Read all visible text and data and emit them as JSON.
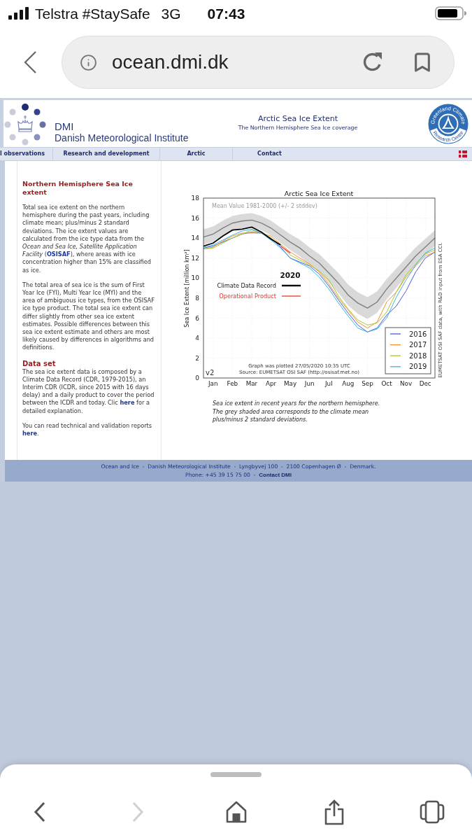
{
  "status_bar": {
    "carrier": "Telstra #StaySafe",
    "network": "3G",
    "time": "07:43"
  },
  "address_bar": {
    "url": "ocean.dmi.dk"
  },
  "site_header": {
    "short_name": "DMI",
    "name": "Danish Meteorological Institute",
    "title": "Arctic Sea Ice Extent",
    "subtitle": "The Northern Hemisphere Sea Ice coverage",
    "partner_logo": {
      "top_text": "Greenland Climate",
      "bottom_text": "Research Centre"
    }
  },
  "nav": [
    {
      "label": "l observations"
    },
    {
      "label": "Research and development"
    },
    {
      "label": "Arctic"
    },
    {
      "label": "Contact"
    }
  ],
  "article": [
    {
      "kind": "title",
      "text": "Northern Hemisphere Sea Ice extent"
    },
    {
      "kind": "paragraph",
      "parts": [
        {
          "kind": "text",
          "text": "Total sea ice extent on the northern hemisphere during the past years, including climate mean; plus/minus 2 standard deviations. The ice extent values are calculated from the ice type data from the *Ocean and Sea Ice, Satellite Application Facility* ("
        },
        {
          "kind": "link",
          "text": "OSISAF"
        },
        {
          "kind": "text",
          "text": "), where areas with ice concentration higher than 15% are classified as ice."
        }
      ]
    },
    {
      "kind": "paragraph",
      "parts": [
        {
          "kind": "text",
          "text": "The total area of sea ice is the sum of First Year Ice (FYI), Multi Year Ice (MYI) and the area of ambiguous ice types, from the OSISAF ice type product. The total sea ice extent can differ slightly from other sea ice extent estimates. Possible differences between this sea ice extent estimate and others are most likely caused by differences in algorithms and definitions."
        }
      ]
    },
    {
      "kind": "heading",
      "text": "Data set"
    },
    {
      "kind": "paragraph",
      "parts": [
        {
          "kind": "text",
          "text": "The sea ice extent data is composed by a Climate Data Record (CDR, 1979-2015), an Interim CDR (ICDR, since 2015 with 16 days delay) and a daily product to cover the period between the ICDR and today. Clic "
        },
        {
          "kind": "link",
          "text": "here"
        },
        {
          "kind": "text",
          "text": " for a detailed explanation."
        }
      ]
    },
    {
      "kind": "paragraph",
      "parts": [
        {
          "kind": "text",
          "text": "You can read technical and validation reports "
        },
        {
          "kind": "link",
          "text": "here"
        },
        {
          "kind": "text",
          "text": "."
        }
      ]
    }
  ],
  "figure": {
    "chart_data": {
      "type": "line",
      "title": "Arctic Sea Ice Extent",
      "ylabel": "Sea Ice Extent [million km²]",
      "categories": [
        null,
        "Jan",
        null,
        "Feb",
        null,
        "Mar",
        null,
        "Apr",
        null,
        "May",
        null,
        "Jun",
        null,
        "Jul",
        null,
        "Aug",
        null,
        "Sep",
        null,
        "Oct",
        null,
        "Nov",
        null,
        "Dec",
        null
      ],
      "ylim": [
        0,
        18
      ],
      "yticks": [
        0,
        2,
        4,
        6,
        8,
        10,
        12,
        14,
        16,
        18
      ],
      "grid": true,
      "legend": true,
      "series": [
        {
          "name": "Mean Value 1981-2000 (+/- 2 stddev)",
          "color": "#7f7f7f",
          "values": [
            14.1,
            14.4,
            15.0,
            15.5,
            15.7,
            15.8,
            15.5,
            15.0,
            14.3,
            13.6,
            13.0,
            12.2,
            11.5,
            10.5,
            9.5,
            8.3,
            7.5,
            7.0,
            7.6,
            8.9,
            10.0,
            11.1,
            12.2,
            13.1,
            14.0
          ]
        },
        {
          "name": "2016",
          "color": "#4a5bd4",
          "values": [
            13.0,
            13.2,
            13.6,
            14.0,
            14.4,
            14.6,
            14.5,
            14.0,
            13.1,
            12.0,
            11.6,
            11.2,
            10.4,
            9.2,
            7.8,
            6.5,
            5.3,
            4.6,
            5.0,
            6.3,
            7.2,
            8.7,
            10.6,
            12.0,
            12.6
          ]
        },
        {
          "name": "2017",
          "color": "#f0922a",
          "values": [
            12.9,
            13.1,
            13.7,
            14.2,
            14.5,
            14.5,
            14.5,
            14.2,
            13.4,
            12.6,
            12.0,
            11.4,
            10.6,
            9.4,
            8.0,
            6.8,
            5.6,
            5.0,
            5.6,
            7.6,
            8.6,
            10.1,
            11.2,
            12.2,
            12.6
          ]
        },
        {
          "name": "2018",
          "color": "#a8c832",
          "values": [
            12.9,
            13.0,
            13.5,
            14.0,
            14.4,
            14.8,
            14.5,
            14.0,
            13.3,
            12.3,
            11.8,
            11.3,
            10.7,
            9.8,
            8.2,
            6.9,
            5.8,
            5.3,
            5.5,
            6.6,
            8.6,
            10.3,
            11.4,
            12.4,
            12.8
          ]
        },
        {
          "name": "2019",
          "color": "#35b5e8",
          "values": [
            13.1,
            13.3,
            13.8,
            14.3,
            14.7,
            14.9,
            14.5,
            13.8,
            13.0,
            12.0,
            11.5,
            11.0,
            10.1,
            8.9,
            7.5,
            6.2,
            5.0,
            4.6,
            4.9,
            6.0,
            8.1,
            9.8,
            11.3,
            12.5,
            13.0
          ]
        },
        {
          "name": "Climate Data Record",
          "color": "#000000",
          "values": [
            13.2,
            13.5,
            14.2,
            14.8,
            14.9,
            15.1,
            14.6,
            13.9,
            13.3,
            null,
            null,
            null,
            null,
            null,
            null,
            null,
            null,
            null,
            null,
            null,
            null,
            null,
            null,
            null,
            null
          ]
        },
        {
          "name": "Operational Product",
          "color": "#e8352a",
          "values": [
            null,
            null,
            null,
            null,
            null,
            null,
            null,
            null,
            13.2,
            12.5,
            null,
            null,
            null,
            null,
            null,
            null,
            null,
            null,
            null,
            null,
            null,
            null,
            null,
            null,
            null
          ]
        }
      ],
      "annotations": [
        {
          "text": "2020"
        },
        {
          "text": "v2"
        },
        {
          "text": "Graph was plotted 27/05/2020 10:35 UTC"
        },
        {
          "text": "Source: EUMETSAT OSI SAF (http://osisaf.met.no)"
        },
        {
          "text": "EUMETSAT OSI SAF data, with R&D input from ESA CCI."
        }
      ]
    },
    "caption": "Sea ice extent in recent years for the northern hemisphere. The grey shaded area corresponds to the climate mean plus/minus 2 standard deviations."
  },
  "footer": {
    "address": "Ocean and Ice  -  Danish Meteorological Institute  -  Lyngbyvej 100  -  2100 Copenhagen Ø  -  Denmark.",
    "phone": "Phone: +45 39 15 75 00  -  ",
    "contact": "Contact DMI"
  },
  "toolbar": [
    {
      "kind": "back",
      "disabled": false
    },
    {
      "kind": "forward",
      "disabled": true
    },
    {
      "kind": "home",
      "disabled": false
    },
    {
      "kind": "share",
      "disabled": false
    },
    {
      "kind": "tabs",
      "disabled": false
    }
  ]
}
